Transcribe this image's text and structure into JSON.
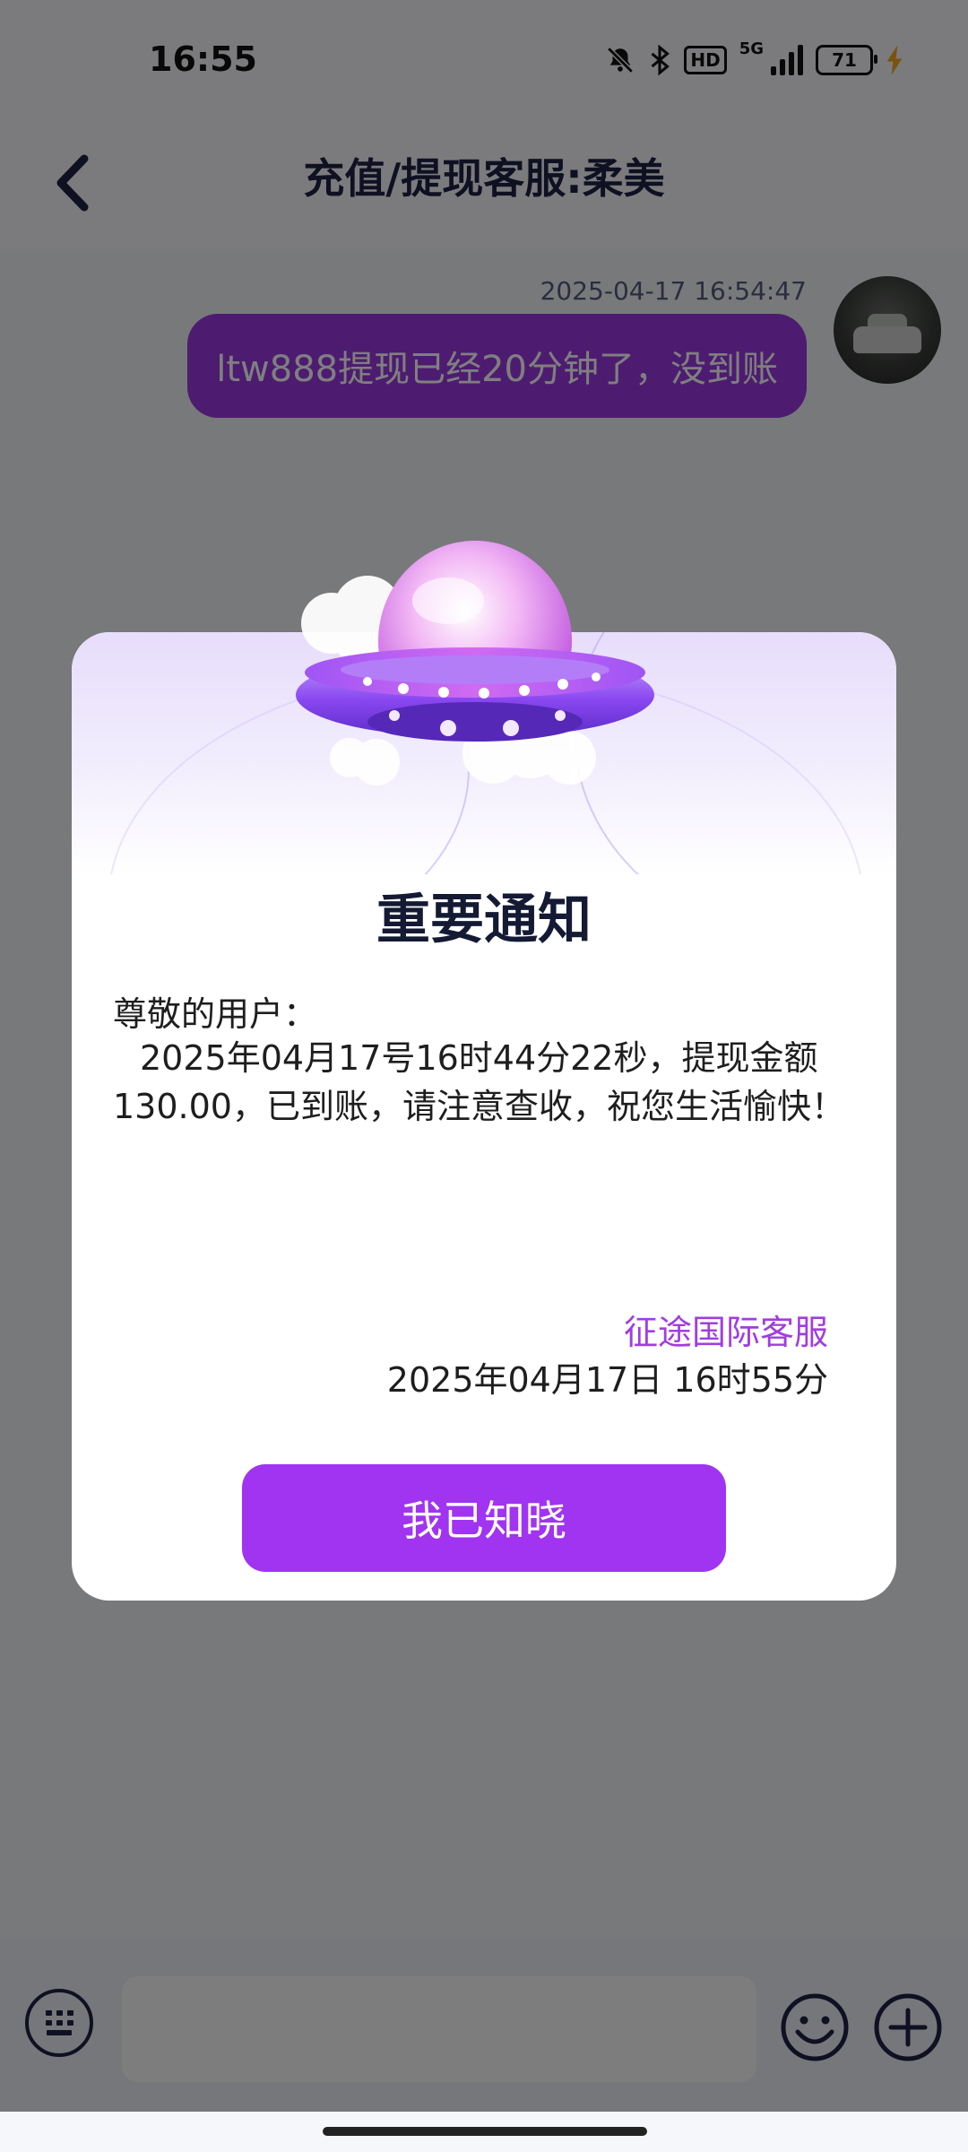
{
  "status_bar": {
    "time": "16:55",
    "network_label": "5G",
    "hd_label": "HD",
    "battery_level": "71",
    "icons": [
      "mute-bell-icon",
      "bluetooth-icon",
      "hd-icon",
      "signal-icon",
      "battery-icon",
      "charging-bolt-icon"
    ]
  },
  "header": {
    "title": "充值/提现客服:柔美",
    "back_icon": "chevron-left-icon"
  },
  "chat": {
    "messages": [
      {
        "time": "2025-04-17 16:54:47",
        "text": "ltw888提现已经20分钟了，没到账",
        "from": "self"
      }
    ]
  },
  "modal": {
    "title": "重要通知",
    "greeting": "尊敬的用户：",
    "body": "2025年04月17号16时44分22秒，提现金额130.00，已到账，请注意查收，祝您生活愉快！",
    "signature": "征途国际客服",
    "date": "2025年04月17日 16时55分",
    "button_label": "我已知晓",
    "illustration": "ufo-illustration"
  },
  "input_bar": {
    "placeholder": "",
    "left_icon": "keyboard-icon",
    "right_icons": [
      "emoji-icon",
      "plus-icon"
    ]
  },
  "colors": {
    "accent": "#a034f0",
    "bubble": "#9a39e0",
    "signature": "#a13de0",
    "title": "#1e2345"
  }
}
